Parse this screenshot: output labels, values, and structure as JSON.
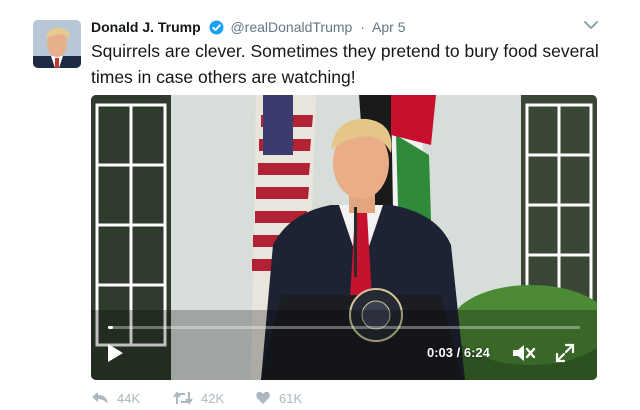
{
  "author": {
    "name": "Donald J. Trump",
    "handle": "@realDonaldTrump",
    "separator": "·",
    "date": "Apr 5",
    "verified": true
  },
  "tweet": {
    "text": "Squirrels are clever. Sometimes they pretend to bury food several times in case others are watching!"
  },
  "video": {
    "current_time": "0:03",
    "time_separator": " / ",
    "duration": "6:24",
    "progress_fraction": 0.008,
    "muted": true
  },
  "actions": {
    "reply_count": "44K",
    "retweet_count": "42K",
    "like_count": "61K"
  },
  "colors": {
    "verified": "#1da1f2",
    "secondary_text": "#657786",
    "action_icons": "#aab8c2"
  }
}
